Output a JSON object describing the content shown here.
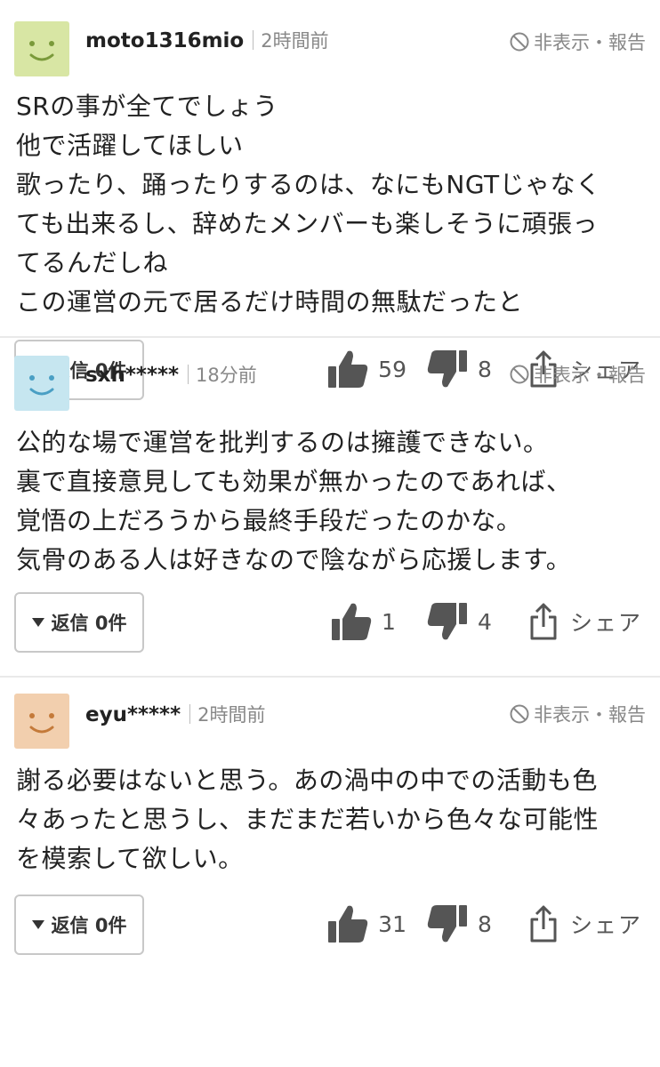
{
  "comments": [
    {
      "username": "moto1316mio",
      "time": "2時間前",
      "hide_report": "非表示・報告",
      "avatar_color": "#d8e6a4",
      "avatar_face_color": "#7a9a3a",
      "body": [
        "SRの事が全てでしょう",
        "他で活躍してほしい",
        "歌ったり、踊ったりするのは、なにもNGTじゃなく",
        "ても出来るし、辞めたメンバーも楽しそうに頑張っ",
        "てるんだしね",
        "この運営の元で居るだけ時間の無駄だったと"
      ],
      "reply_label": "返信 0件",
      "likes": "59",
      "dislikes": "8",
      "share_label": "シェア"
    },
    {
      "username": "sxh*****",
      "time": "18分前",
      "hide_report": "非表示・報告",
      "avatar_color": "#c6e6f0",
      "avatar_face_color": "#4a9fc4",
      "body": [
        "公的な場で運営を批判するのは擁護できない。",
        "裏で直接意見しても効果が無かったのであれば、",
        "覚悟の上だろうから最終手段だったのかな。",
        "気骨のある人は好きなので陰ながら応援します。"
      ],
      "reply_label": "返信 0件",
      "likes": "1",
      "dislikes": "4",
      "share_label": "シェア"
    },
    {
      "username": "eyu*****",
      "time": "2時間前",
      "hide_report": "非表示・報告",
      "avatar_color": "#f2cfae",
      "avatar_face_color": "#c47a3a",
      "body": [
        "謝る必要はないと思う。あの渦中の中での活動も色",
        "々あったと思うし、まだまだ若いから色々な可能性",
        "を模索して欲しい。"
      ],
      "reply_label": "返信 0件",
      "likes": "31",
      "dislikes": "8",
      "share_label": "シェア"
    }
  ]
}
